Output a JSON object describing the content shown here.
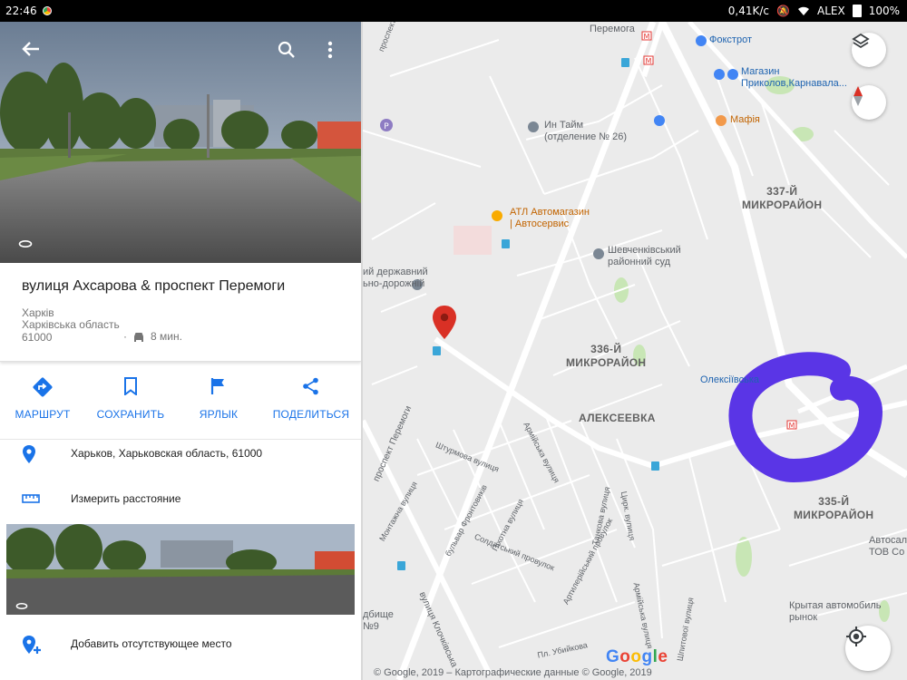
{
  "status_bar": {
    "time": "22:46",
    "network_speed": "0,41K/c",
    "carrier": "ALEX",
    "battery": "100%"
  },
  "place": {
    "title": "вулиця Ахсарова & проспект Перемоги",
    "address_lines": [
      "Харків",
      "Харківська область",
      "61000"
    ],
    "drive_time": "8 мин."
  },
  "actions": [
    {
      "label": "МАРШРУТ",
      "icon": "directions-icon"
    },
    {
      "label": "СОХРАНИТЬ",
      "icon": "bookmark-icon"
    },
    {
      "label": "ЯРЛЫК",
      "icon": "flag-icon"
    },
    {
      "label": "ПОДЕЛИТЬСЯ",
      "icon": "share-icon"
    }
  ],
  "details": {
    "address": "Харьков, Харьковская область, 61000",
    "measure": "Измерить расстояние",
    "add_place": "Добавить отсутствующее место"
  },
  "map": {
    "districts": {
      "d337_line1": "337-Й",
      "d337_line2": "МИКРОРАЙОН",
      "d336_line1": "336-Й",
      "d336_line2": "МИКРОРАЙОН",
      "alekseevka": "АЛЕКСЕЕВКА",
      "d335_line1": "335-Й",
      "d335_line2": "МИКРОРАЙОН"
    },
    "pois": {
      "foxtrot": "Фокстрот",
      "shop_line1": "Магазин",
      "shop_line2": "Приколов,Карнавала...",
      "in_time_line1": "Ин Тайм",
      "in_time_line2": "(отделение № 26)",
      "mafia": "Мафія",
      "atl_line1": "АТЛ Автомагазин",
      "atl_line2": "| Автосервис",
      "court_line1": "Шевченківський",
      "court_line2": "районний суд",
      "univ_line1": "ий державний",
      "univ_line2": "ьно-дорожній",
      "oleksiivska": "Олексіївська",
      "autosalon_line1": "Автосало",
      "autosalon_line2": "ТОВ Со",
      "market_line1": "Крытая автомобиль",
      "market_line2": "рынок",
      "peremoha_top": "Перемога",
      "dbyshe_line1": "дбище",
      "dbyshe_line2": "№9"
    },
    "streets": {
      "peremohy": "проспект Перемоги",
      "shturmova": "Штурмова вулиця",
      "armiiska": "Армійська вулиця",
      "montazhna": "Монтажна вулиця",
      "frontovykiv": "бульвар Фронтовиків",
      "pikhotna": "Піхотна вулиця",
      "soldatskyi": "Солдатський провулок",
      "artyleriiskyi": "Артилерійський провулок",
      "tsyrkuniv": "Цирк. вулиця",
      "tankova": "Танкова вулиця",
      "armiiska2": "Армійська вулиця",
      "klochkivska": "вулиця Клочківська",
      "ubiikova": "Пл. Убийкова",
      "shpytovoi": "Шпитової вулиця",
      "top_road": "проспект"
    },
    "google_logo": "Google",
    "copyright": "© Google, 2019 – Картографические данные © Google, 2019"
  },
  "colors": {
    "accent": "#1a73e8",
    "pin": "#d93025",
    "metro": "#e53935",
    "annotation": "#5a35e6"
  }
}
